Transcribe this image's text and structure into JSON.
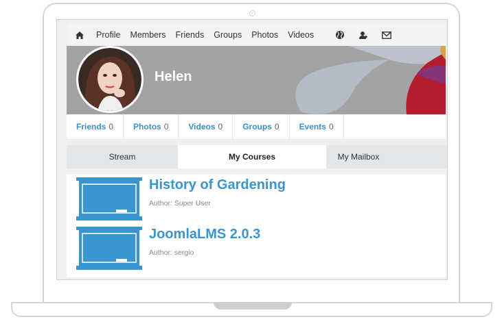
{
  "nav": {
    "items": [
      "Profile",
      "Members",
      "Friends",
      "Groups",
      "Photos",
      "Videos"
    ]
  },
  "profile": {
    "name": "Helen"
  },
  "counts": [
    {
      "label": "Friends",
      "value": "0"
    },
    {
      "label": "Photos",
      "value": "0"
    },
    {
      "label": "Videos",
      "value": "0"
    },
    {
      "label": "Groups",
      "value": "0"
    },
    {
      "label": "Events",
      "value": "0"
    }
  ],
  "tabs": {
    "stream": "Stream",
    "courses": "My Courses",
    "mailbox": "My Mailbox"
  },
  "courses": [
    {
      "title": "History of Gardening",
      "author": "Author: Super User"
    },
    {
      "title": "JoomlaLMS 2.0.3",
      "author": "Author: sergio"
    }
  ],
  "colors": {
    "accent": "#3a95cf",
    "cover": "#a3a3a3",
    "tab_bar": "#e3e6e8"
  },
  "icons": {
    "home": "home-icon",
    "globe": "globe-icon",
    "user": "user-icon",
    "mail": "envelope-icon"
  }
}
